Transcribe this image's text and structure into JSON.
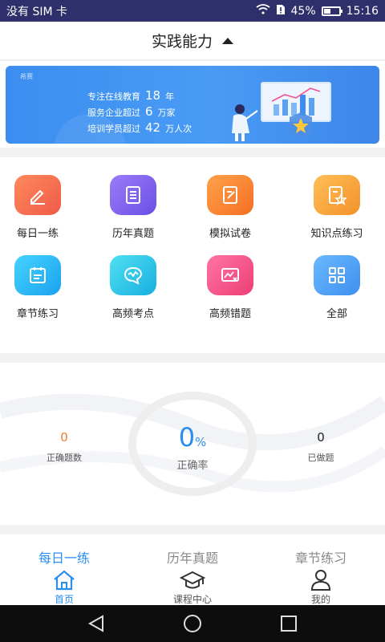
{
  "status_bar": {
    "carrier": "没有 SIM 卡",
    "battery": "45%",
    "battery_level": 0.45,
    "time": "15:16"
  },
  "header": {
    "title": "实践能力"
  },
  "banner": {
    "brand": "希赛",
    "lines": [
      {
        "pre": "专注在线教育",
        "num": "18",
        "post": "年"
      },
      {
        "pre": "服务企业超过",
        "num": "6",
        "post": "万家"
      },
      {
        "pre": "培训学员超过",
        "num": "42",
        "post": "万人次"
      }
    ]
  },
  "grid": {
    "items": [
      {
        "label": "每日一练",
        "icon": "pencil-icon",
        "color": "#f26a4f"
      },
      {
        "label": "历年真题",
        "icon": "document-icon",
        "color": "#7b5cf0"
      },
      {
        "label": "模拟试卷",
        "icon": "exam-paper-icon",
        "color": "#f7862f"
      },
      {
        "label": "知识点练习",
        "icon": "star-doc-icon",
        "color": "#f5a13a"
      },
      {
        "label": "章节练习",
        "icon": "calendar-icon",
        "color": "#30b9f2"
      },
      {
        "label": "高频考点",
        "icon": "chat-wave-icon",
        "color": "#2bc6e8"
      },
      {
        "label": "高频错题",
        "icon": "chart-error-icon",
        "color": "#f2548a"
      },
      {
        "label": "全部",
        "icon": "grid-icon",
        "color": "#4aa2f3"
      }
    ]
  },
  "stats": {
    "correct_count": "0",
    "correct_count_label": "正确题数",
    "accuracy": "0",
    "accuracy_unit": "%",
    "accuracy_label": "正确率",
    "done_count": "0",
    "done_count_label": "已做题"
  },
  "bottom_tabs": [
    {
      "upper": "每日一练",
      "lower": "首页",
      "icon": "home-icon",
      "active": true
    },
    {
      "upper": "历年真题",
      "lower": "课程中心",
      "icon": "graduation-cap-icon",
      "active": false
    },
    {
      "upper": "章节练习",
      "lower": "我的",
      "icon": "person-icon",
      "active": false
    }
  ],
  "colors": {
    "accent": "#2a8ef1",
    "orange": "#ef7b2a"
  }
}
